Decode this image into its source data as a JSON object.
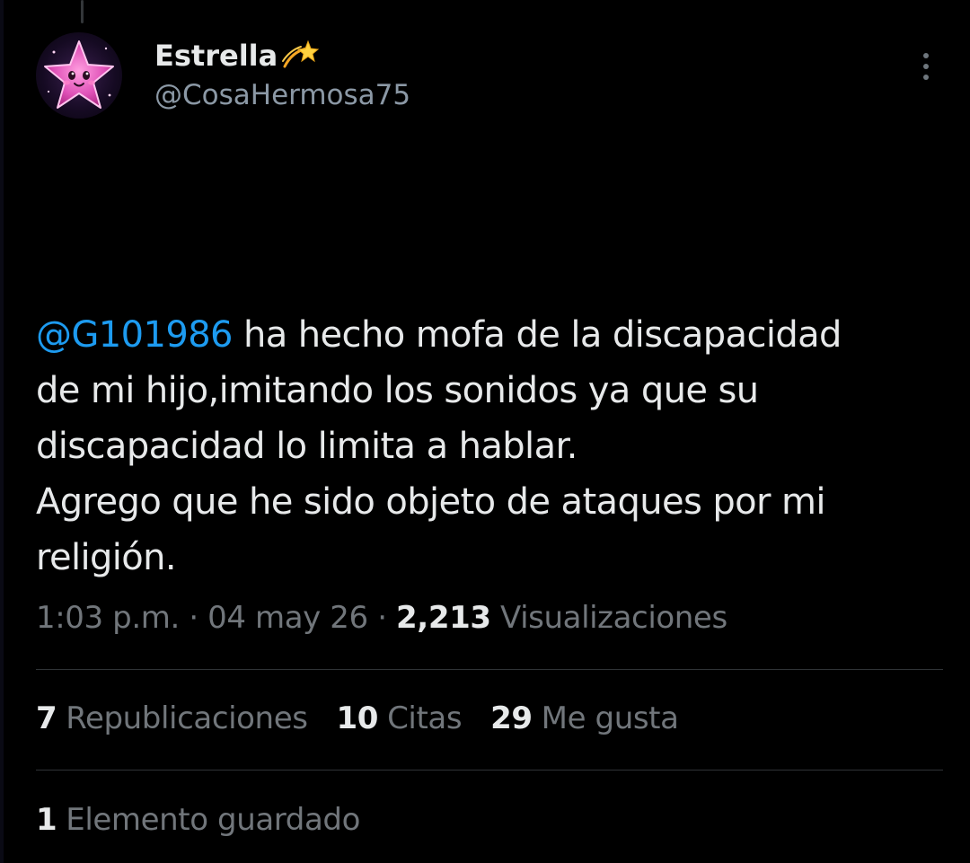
{
  "author": {
    "display_name": "Estrella",
    "name_emoji_icon": "dizzy-star-emoji",
    "handle": "@CosaHermosa75",
    "avatar_icon": "pink-star-character"
  },
  "tweet": {
    "mention": "@G101986",
    "line1_rest": " ha hecho mofa de la discapacidad",
    "line2": "de mi hijo,imitando los sonidos ya que su",
    "line3": "discapacidad lo limita a hablar.",
    "line4": "Agrego que he sido objeto de ataques por mi",
    "line5": "religión."
  },
  "meta": {
    "time": "1:03 p.m.",
    "separator": "·",
    "date": "04 may 26",
    "views_count": "2,213",
    "views_label": "Visualizaciones"
  },
  "stats": {
    "reposts_count": "7",
    "reposts_label": "Republicaciones",
    "quotes_count": "10",
    "quotes_label": "Citas",
    "likes_count": "29",
    "likes_label": "Me gusta"
  },
  "bookmarks": {
    "count": "1",
    "label": "Elemento guardado"
  },
  "colors": {
    "background": "#000000",
    "text_primary": "#e7e9ea",
    "text_secondary": "#71767b",
    "mention": "#1d9bf0",
    "divider": "#2f3336"
  },
  "icons": {
    "more_options": "more-vertical-icon"
  }
}
